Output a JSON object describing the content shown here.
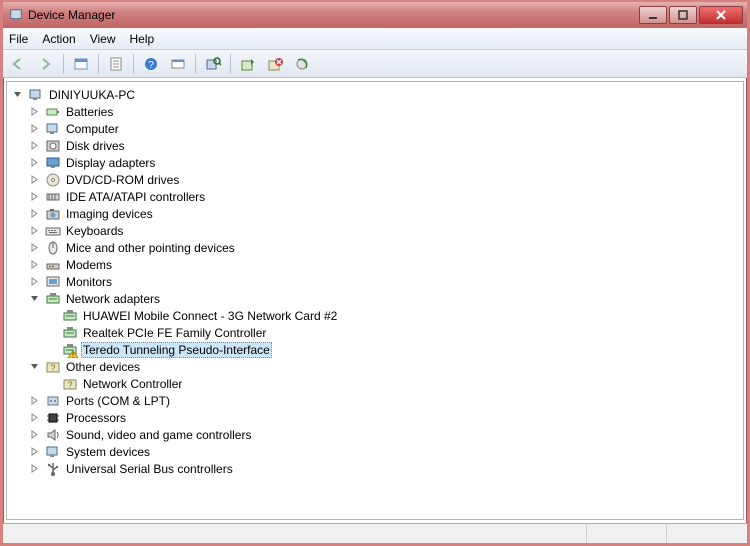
{
  "window": {
    "title": "Device Manager"
  },
  "menu": {
    "file": "File",
    "action": "Action",
    "view": "View",
    "help": "Help"
  },
  "tree": {
    "root": "DINIYUUKA-PC",
    "items": [
      {
        "label": "Batteries",
        "collapsed": true,
        "icon": "battery"
      },
      {
        "label": "Computer",
        "collapsed": true,
        "icon": "pc"
      },
      {
        "label": "Disk drives",
        "collapsed": true,
        "icon": "disk"
      },
      {
        "label": "Display adapters",
        "collapsed": true,
        "icon": "display"
      },
      {
        "label": "DVD/CD-ROM drives",
        "collapsed": true,
        "icon": "cd"
      },
      {
        "label": "IDE ATA/ATAPI controllers",
        "collapsed": true,
        "icon": "ide"
      },
      {
        "label": "Imaging devices",
        "collapsed": true,
        "icon": "camera"
      },
      {
        "label": "Keyboards",
        "collapsed": true,
        "icon": "keyboard"
      },
      {
        "label": "Mice and other pointing devices",
        "collapsed": true,
        "icon": "mouse"
      },
      {
        "label": "Modems",
        "collapsed": true,
        "icon": "modem"
      },
      {
        "label": "Monitors",
        "collapsed": true,
        "icon": "monitor"
      },
      {
        "label": "Network adapters",
        "collapsed": false,
        "icon": "net",
        "children": [
          {
            "label": "HUAWEI Mobile Connect - 3G Network Card #2",
            "icon": "net"
          },
          {
            "label": "Realtek PCIe FE Family Controller",
            "icon": "net"
          },
          {
            "label": "Teredo Tunneling Pseudo-Interface",
            "icon": "net-warn",
            "selected": true
          }
        ]
      },
      {
        "label": "Other devices",
        "collapsed": false,
        "icon": "other",
        "children": [
          {
            "label": "Network Controller",
            "icon": "other"
          }
        ]
      },
      {
        "label": "Ports (COM & LPT)",
        "collapsed": true,
        "icon": "port"
      },
      {
        "label": "Processors",
        "collapsed": true,
        "icon": "cpu"
      },
      {
        "label": "Sound, video and game controllers",
        "collapsed": true,
        "icon": "sound"
      },
      {
        "label": "System devices",
        "collapsed": true,
        "icon": "pc"
      },
      {
        "label": "Universal Serial Bus controllers",
        "collapsed": true,
        "icon": "usb"
      }
    ]
  }
}
